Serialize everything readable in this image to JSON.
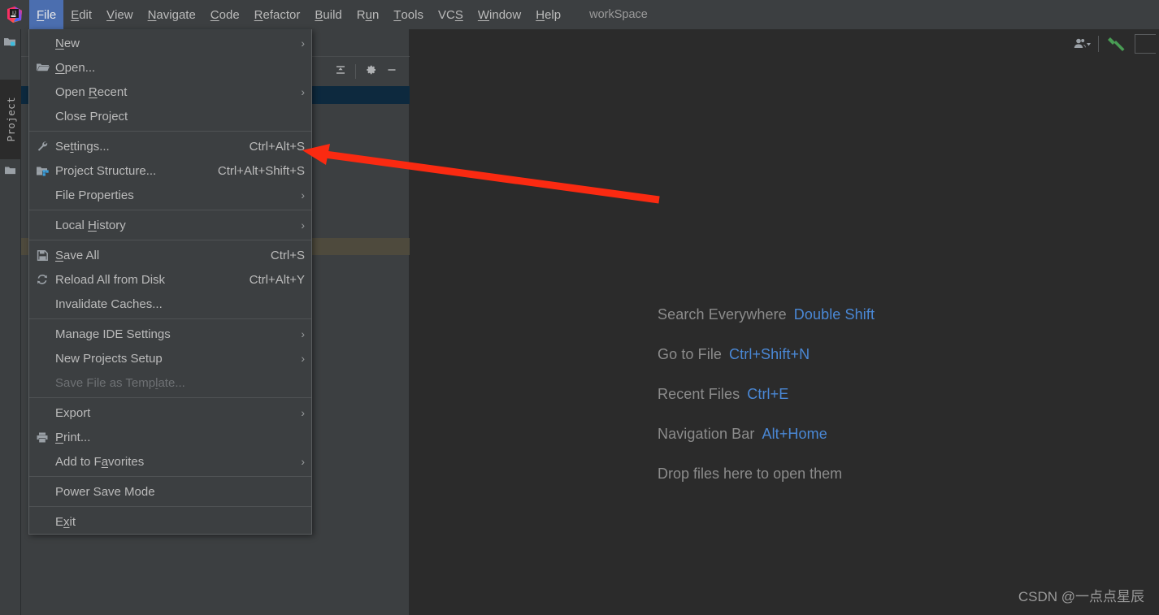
{
  "window": {
    "app_logo": "intellij-idea-logo",
    "project_name": "workSpace",
    "background_editor_color": "#2b2b2b",
    "background_panel_color": "#3c3f41",
    "accent_color": "#4b6eaf",
    "link_color": "#4a88d6",
    "annotation_color": "#fa2a11"
  },
  "menubar": {
    "items": [
      {
        "label": "File",
        "mnemonic": "F",
        "active": true
      },
      {
        "label": "Edit",
        "mnemonic": "E",
        "active": false
      },
      {
        "label": "View",
        "mnemonic": "V",
        "active": false
      },
      {
        "label": "Navigate",
        "mnemonic": "N",
        "active": false
      },
      {
        "label": "Code",
        "mnemonic": "C",
        "active": false
      },
      {
        "label": "Refactor",
        "mnemonic": "R",
        "active": false
      },
      {
        "label": "Build",
        "mnemonic": "B",
        "active": false
      },
      {
        "label": "Run",
        "mnemonic": "u",
        "active": false
      },
      {
        "label": "Tools",
        "mnemonic": "T",
        "active": false
      },
      {
        "label": "VCS",
        "mnemonic": "S",
        "active": false
      },
      {
        "label": "Window",
        "mnemonic": "W",
        "active": false
      },
      {
        "label": "Help",
        "mnemonic": "H",
        "active": false
      }
    ]
  },
  "toolbar_right": {
    "icons": [
      "user-account-icon",
      "chevron-down-icon",
      "build-hammer-icon"
    ]
  },
  "left_tool_strip": {
    "tab_label": "Project",
    "icons": [
      "project-folder-icon",
      "folder-icon"
    ]
  },
  "project_panel": {
    "toolbar_icons": [
      "collapse-all-icon",
      "gear-icon",
      "minimize-icon"
    ]
  },
  "file_menu": {
    "items": [
      {
        "label": "New",
        "mnemonic": "N",
        "icon": "",
        "accel": "",
        "submenu": true,
        "disabled": false,
        "sep_after": false
      },
      {
        "label": "Open...",
        "mnemonic": "O",
        "icon": "open-folder-icon",
        "accel": "",
        "submenu": false,
        "disabled": false,
        "sep_after": false
      },
      {
        "label": "Open Recent",
        "mnemonic": "R",
        "icon": "",
        "accel": "",
        "submenu": true,
        "disabled": false,
        "sep_after": false
      },
      {
        "label": "Close Project",
        "mnemonic": "",
        "icon": "",
        "accel": "",
        "submenu": false,
        "disabled": false,
        "sep_after": true
      },
      {
        "label": "Settings...",
        "mnemonic": "t",
        "icon": "wrench-icon",
        "accel": "Ctrl+Alt+S",
        "submenu": false,
        "disabled": false,
        "sep_after": false
      },
      {
        "label": "Project Structure...",
        "mnemonic": "",
        "icon": "project-structure-icon",
        "accel": "Ctrl+Alt+Shift+S",
        "submenu": false,
        "disabled": false,
        "sep_after": false
      },
      {
        "label": "File Properties",
        "mnemonic": "",
        "icon": "",
        "accel": "",
        "submenu": true,
        "disabled": false,
        "sep_after": true
      },
      {
        "label": "Local History",
        "mnemonic": "H",
        "icon": "",
        "accel": "",
        "submenu": true,
        "disabled": false,
        "sep_after": true
      },
      {
        "label": "Save All",
        "mnemonic": "S",
        "icon": "save-floppy-icon",
        "accel": "Ctrl+S",
        "submenu": false,
        "disabled": false,
        "sep_after": false
      },
      {
        "label": "Reload All from Disk",
        "mnemonic": "",
        "icon": "reload-refresh-icon",
        "accel": "Ctrl+Alt+Y",
        "submenu": false,
        "disabled": false,
        "sep_after": false
      },
      {
        "label": "Invalidate Caches...",
        "mnemonic": "",
        "icon": "",
        "accel": "",
        "submenu": false,
        "disabled": false,
        "sep_after": true
      },
      {
        "label": "Manage IDE Settings",
        "mnemonic": "",
        "icon": "",
        "accel": "",
        "submenu": true,
        "disabled": false,
        "sep_after": false
      },
      {
        "label": "New Projects Setup",
        "mnemonic": "",
        "icon": "",
        "accel": "",
        "submenu": true,
        "disabled": false,
        "sep_after": false
      },
      {
        "label": "Save File as Template...",
        "mnemonic": "l",
        "icon": "",
        "accel": "",
        "submenu": false,
        "disabled": true,
        "sep_after": true
      },
      {
        "label": "Export",
        "mnemonic": "",
        "icon": "",
        "accel": "",
        "submenu": true,
        "disabled": false,
        "sep_after": false
      },
      {
        "label": "Print...",
        "mnemonic": "P",
        "icon": "printer-icon",
        "accel": "",
        "submenu": false,
        "disabled": false,
        "sep_after": false
      },
      {
        "label": "Add to Favorites",
        "mnemonic": "a",
        "icon": "",
        "accel": "",
        "submenu": true,
        "disabled": false,
        "sep_after": true
      },
      {
        "label": "Power Save Mode",
        "mnemonic": "",
        "icon": "",
        "accel": "",
        "submenu": false,
        "disabled": false,
        "sep_after": true
      },
      {
        "label": "Exit",
        "mnemonic": "x",
        "icon": "",
        "accel": "",
        "submenu": false,
        "disabled": false,
        "sep_after": false
      }
    ]
  },
  "editor_placeholder": {
    "shortcuts": [
      {
        "label": "Search Everywhere",
        "key": "Double Shift"
      },
      {
        "label": "Go to File",
        "key": "Ctrl+Shift+N"
      },
      {
        "label": "Recent Files",
        "key": "Ctrl+E"
      },
      {
        "label": "Navigation Bar",
        "key": "Alt+Home"
      }
    ],
    "drop_hint": "Drop files here to open them"
  },
  "watermark": {
    "text": "CSDN @一点点星辰"
  }
}
